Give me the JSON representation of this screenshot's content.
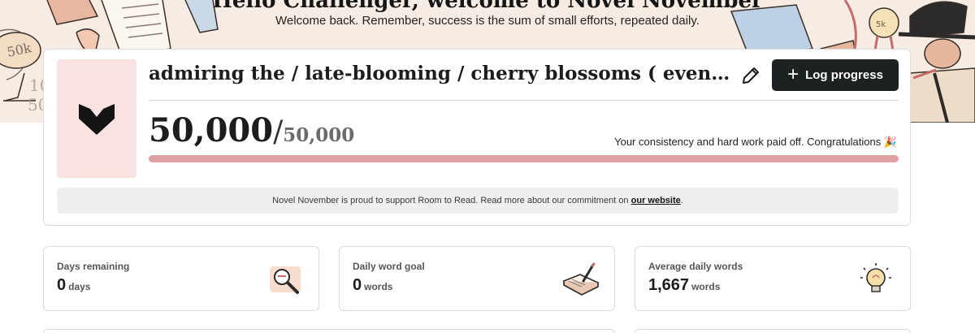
{
  "hero": {
    "title": "Hello Challenger, welcome to Novel November",
    "subtitle": "Welcome back. Remember, success is the sum of small efforts, repeated daily."
  },
  "project": {
    "title": "admiring the / late-blooming / cherry blossoms ( eventually, decorated )",
    "current_words": "50,000",
    "separator": "/",
    "goal_words": "50,000",
    "progress_fraction": 1.0,
    "congrats": "Your consistency and hard work paid off. Congratulations 🎉",
    "log_button": "Log progress",
    "edit_icon": "pencil-icon",
    "cover_icon": "book-heart-icon"
  },
  "notice": {
    "text": "Novel November is proud to support Room to Read. Read more about our commitment on ",
    "link": "our website",
    "suffix": "."
  },
  "stats": [
    {
      "label": "Days remaining",
      "value": "0",
      "unit": "days",
      "icon": "magnifier-icon"
    },
    {
      "label": "Daily word goal",
      "value": "0",
      "unit": "words",
      "icon": "notebook-pen-icon"
    },
    {
      "label": "Average daily words",
      "value": "1,667",
      "unit": "words",
      "icon": "lightbulb-icon"
    }
  ],
  "colors": {
    "accent": "#e0a1a3",
    "cover_bg": "#f9e2e2",
    "button_bg": "#1b2221",
    "hero_bg": "#f6ece4"
  }
}
